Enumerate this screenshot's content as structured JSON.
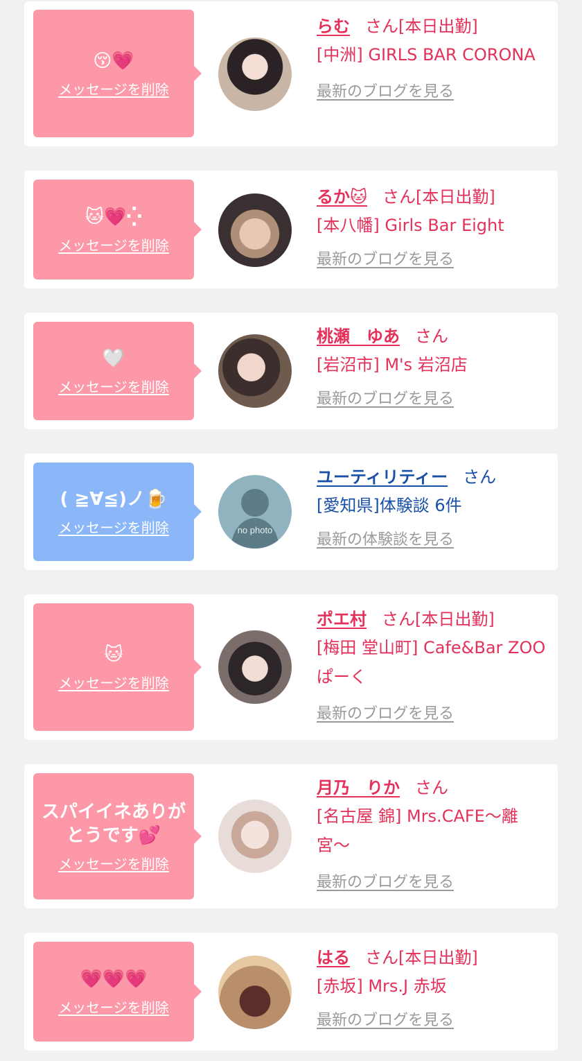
{
  "items": [
    {
      "bubble_color": "#fd98a8",
      "message": "😚💗",
      "delete_label": "メッセージを削除",
      "name": "らむ",
      "honorific": "さん",
      "status": "[本日出勤]",
      "shop": "[中洲] GIRLS BAR CORONA",
      "link": "最新のブログを見る"
    },
    {
      "bubble_color": "#fd98a8",
      "message": "🐱💗⁛",
      "delete_label": "メッセージを削除",
      "name": "るか🐱",
      "honorific": "さん",
      "status": "[本日出勤]",
      "shop": "[本八幡] Girls Bar Eight",
      "link": "最新のブログを見る"
    },
    {
      "bubble_color": "#fd98a8",
      "message": "🤍",
      "delete_label": "メッセージを削除",
      "name": "桃瀬　ゆあ",
      "honorific": "さん",
      "status": "",
      "shop": "[岩沼市] M's 岩沼店",
      "link": "最新のブログを見る"
    },
    {
      "bubble_color": "#8bb7f8",
      "message": "( ≧∀≦)ノ🍺",
      "delete_label": "メッセージを削除",
      "name": "ユーティリティー",
      "honorific": "さん",
      "status": "",
      "shop": "[愛知県]体験談 6件",
      "link": "最新の体験談を見る",
      "avatar_text": "no photo"
    },
    {
      "bubble_color": "#fd98a8",
      "message": "🐱",
      "delete_label": "メッセージを削除",
      "name": "ポエ村",
      "honorific": "さん",
      "status": "[本日出勤]",
      "shop": "[梅田 堂山町] Cafe&Bar ZOOぱーく",
      "link": "最新のブログを見る"
    },
    {
      "bubble_color": "#fd98a8",
      "message": "スパイイネありがとうです💕",
      "delete_label": "メッセージを削除",
      "name": "月乃　りか",
      "honorific": "さん",
      "status": "",
      "shop": "[名古屋 錦] Mrs.CAFE〜離宮〜",
      "link": "最新のブログを見る"
    },
    {
      "bubble_color": "#fd98a8",
      "message": "💗💗💗",
      "delete_label": "メッセージを削除",
      "name": "はる",
      "honorific": "さん",
      "status": "[本日出勤]",
      "shop": "[赤坂] Mrs.J 赤坂",
      "link": "最新のブログを見る"
    }
  ]
}
